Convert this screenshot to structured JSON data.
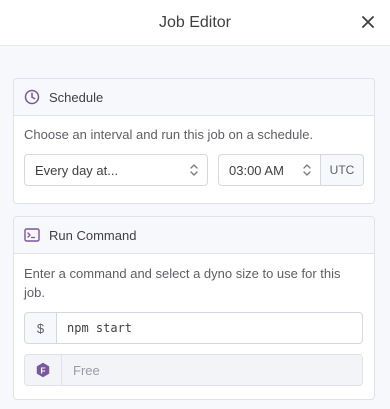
{
  "header": {
    "title": "Job Editor"
  },
  "schedule": {
    "title": "Schedule",
    "description": "Choose an interval and run this job on a schedule.",
    "interval": "Every day at...",
    "time": "03:00 AM",
    "timezone": "UTC"
  },
  "run_command": {
    "title": "Run Command",
    "description": "Enter a command and select a dyno size to use for this job.",
    "prefix": "$",
    "command": "npm start",
    "dyno_badge": "F",
    "dyno_size": "Free"
  },
  "colors": {
    "accent_purple": "#79589f",
    "text": "#3f3f44"
  }
}
